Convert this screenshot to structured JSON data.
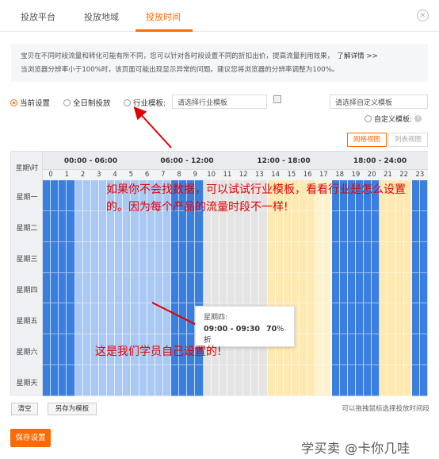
{
  "tabs": [
    {
      "label": "投放平台"
    },
    {
      "label": "投放地域"
    },
    {
      "label": "投放时间"
    }
  ],
  "close_glyph": "×",
  "notice": {
    "line1": "宝贝在不同时段流量和转化可能有所不同，您可以针对各时段设置不同的折扣出价，提高流量利用效果，",
    "link": "了解详情 >>",
    "line2": "当浏览器分辨率小于100%时，该页面可能出现显示异常的问题。建议您将浏览器的分辨率调整为100%。"
  },
  "options": {
    "current": "当前设置",
    "allday": "全日制投放",
    "industry": "行业模板:",
    "industry_placeholder": "请选择行业模板",
    "custom_placeholder": "请选择自定义模板",
    "custom_label": "自定义模板:",
    "help_glyph": "?"
  },
  "views": {
    "grid": "网格视图",
    "list": "列表视图"
  },
  "schedule": {
    "corner": "星期\\时",
    "periods": [
      "00:00 - 06:00",
      "06:00 - 12:00",
      "12:00 - 18:00",
      "18:00 - 24:00"
    ],
    "hours": [
      "0",
      "1",
      "2",
      "3",
      "4",
      "5",
      "6",
      "7",
      "8",
      "9",
      "10",
      "11",
      "12",
      "13",
      "14",
      "15",
      "16",
      "17",
      "18",
      "19",
      "20",
      "21",
      "22",
      "23"
    ],
    "days": [
      "星期一",
      "星期二",
      "星期三",
      "星期四",
      "星期五",
      "星期六",
      "星期天"
    ]
  },
  "tooltip": {
    "day": "星期四:",
    "time": "09:00 - 09:30",
    "percent": "70",
    "unit": "%折"
  },
  "annotations": {
    "text1": "如果你不会找数据，可以试试行业模板，看看行业是怎么设置的。因为每个产品的流量时段不一样!",
    "text2": "这是我们学员自己设置的!"
  },
  "buttons": {
    "clear": "清空",
    "save_as": "另存为模板",
    "hint": "可以拖拽鼠标选择投放时间段",
    "save": "保存设置"
  },
  "watermark": "学买卖 @卡你几哇",
  "colors": {
    "accent": "#ff6a00",
    "strong_blue": "#3a7fe0",
    "light_blue": "#a9c8f4",
    "gray": "#e4e4e4",
    "light_yellow": "#fde9b1",
    "pale_yellow": "#fbf2cf",
    "annotation_red": "#e00000"
  }
}
